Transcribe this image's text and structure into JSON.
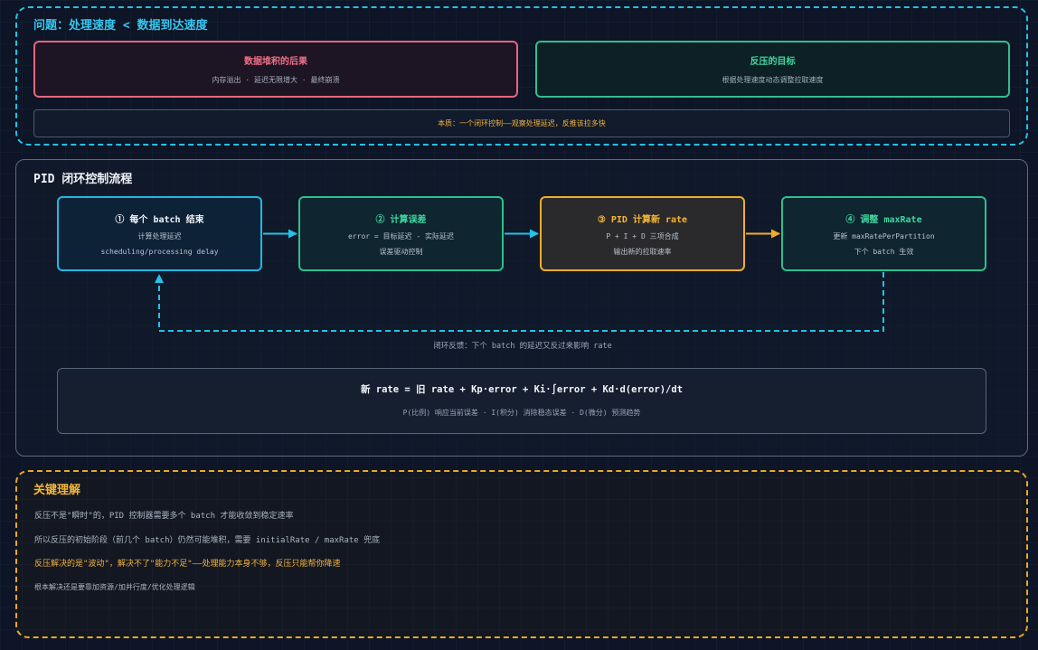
{
  "problem": {
    "title": "问题：处理速度 < 数据到达速度",
    "consequence": {
      "title": "数据堆积的后果",
      "desc": "内存溢出 · 延迟无限增大 · 最终崩溃"
    },
    "goal": {
      "title": "反压的目标",
      "desc": "根据处理速度动态调整拉取速度"
    },
    "essence": "本质：一个闭环控制——观察处理延迟，反推该拉多快"
  },
  "pid_flow": {
    "title": "PID 闭环控制流程",
    "steps": [
      {
        "title": "① 每个 batch 结束",
        "line1": "计算处理延迟",
        "line2": "scheduling/processing delay"
      },
      {
        "title": "② 计算误差",
        "line1": "error = 目标延迟 - 实际延迟",
        "line2": "误差驱动控制"
      },
      {
        "title": "③ PID 计算新 rate",
        "line1": "P + I + D 三项合成",
        "line2": "输出新的拉取速率"
      },
      {
        "title": "④ 调整 maxRate",
        "line1": "更新 maxRatePerPartition",
        "line2": "下个 batch 生效"
      }
    ],
    "loop_caption": "闭环反馈：下个 batch 的延迟又反过来影响 rate",
    "formula": "新 rate = 旧 rate + Kp·error + Ki·∫error + Kd·d(error)/dt",
    "formula_note": "P(比例) 响应当前误差 · I(积分) 消除稳态误差 · D(微分) 预测趋势"
  },
  "key_insights": {
    "title": "关键理解",
    "points": [
      "反压不是\"瞬时\"的，PID 控制器需要多个 batch 才能收敛到稳定速率",
      "所以反压的初始阶段（前几个 batch）仍然可能堆积，需要 initialRate / maxRate 兜底",
      "反压解决的是\"波动\"，解决不了\"能力不足\"——处理能力本身不够，反压只能帮你降速",
      "根本解决还是要靠加资源/加并行度/优化处理逻辑"
    ]
  },
  "colors": {
    "cyan": "#22c3e6",
    "green": "#2fbf8e",
    "amber": "#f2ad28",
    "red": "#e5667f"
  }
}
